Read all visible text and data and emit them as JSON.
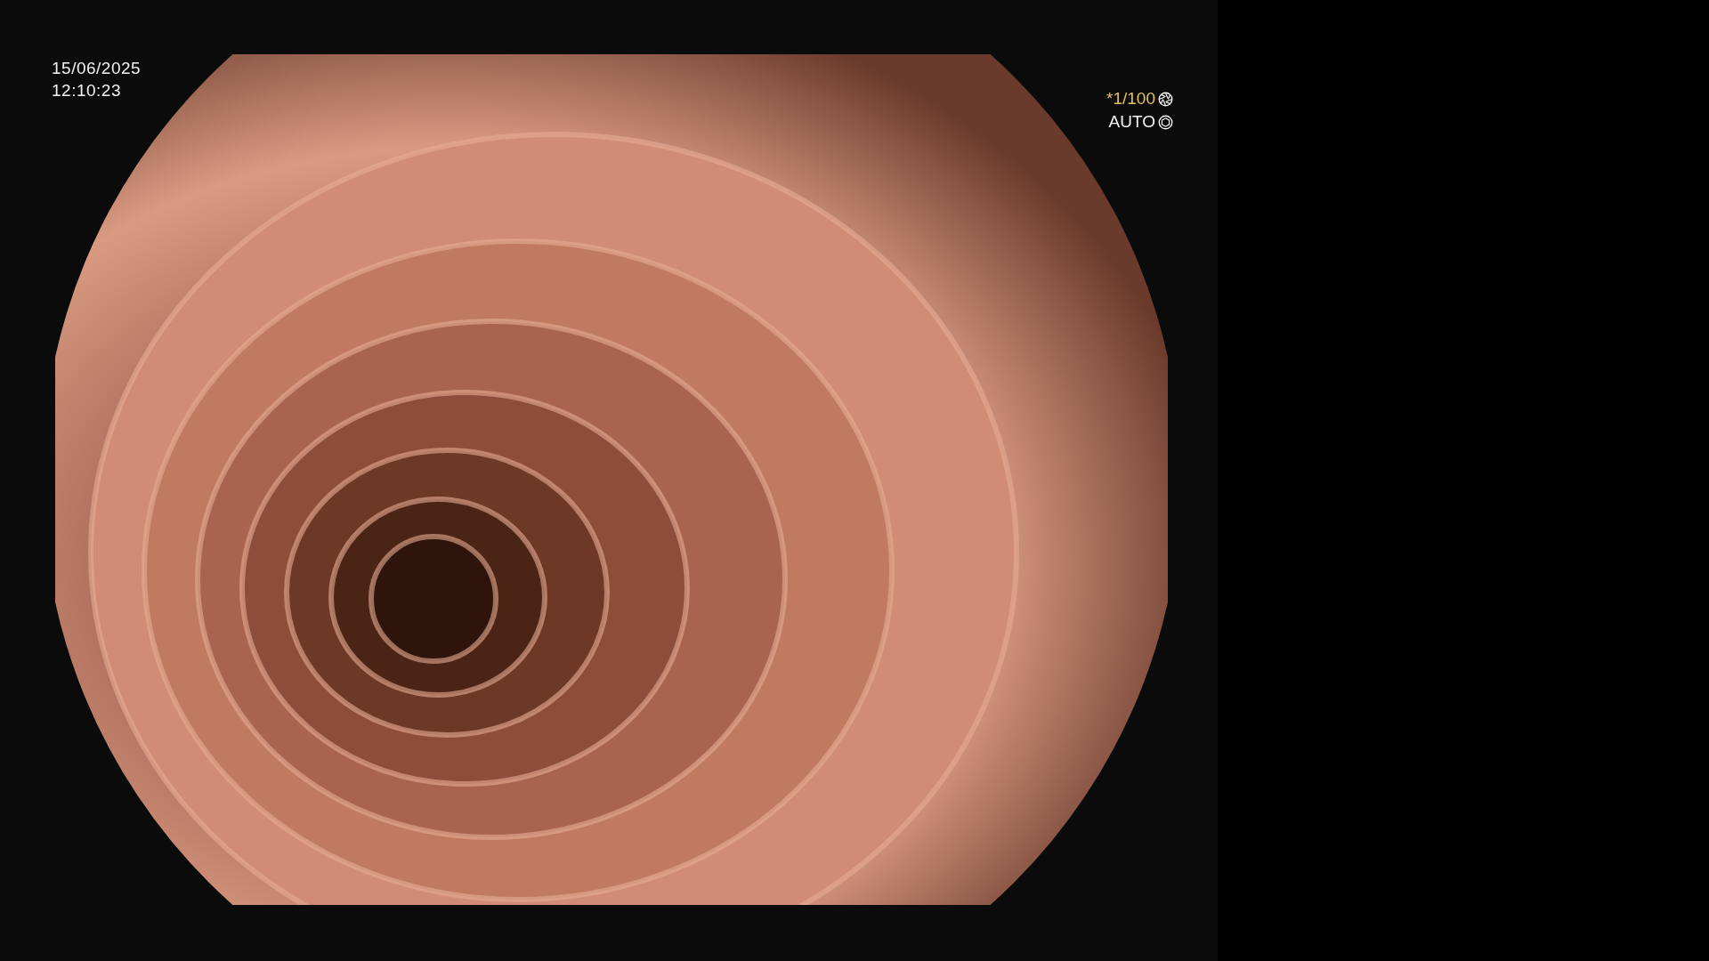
{
  "timestamp": {
    "date": "15/06/2025",
    "time": "12:10:23"
  },
  "exposure": {
    "shutter": "*1/100",
    "iris": "AUTO"
  }
}
